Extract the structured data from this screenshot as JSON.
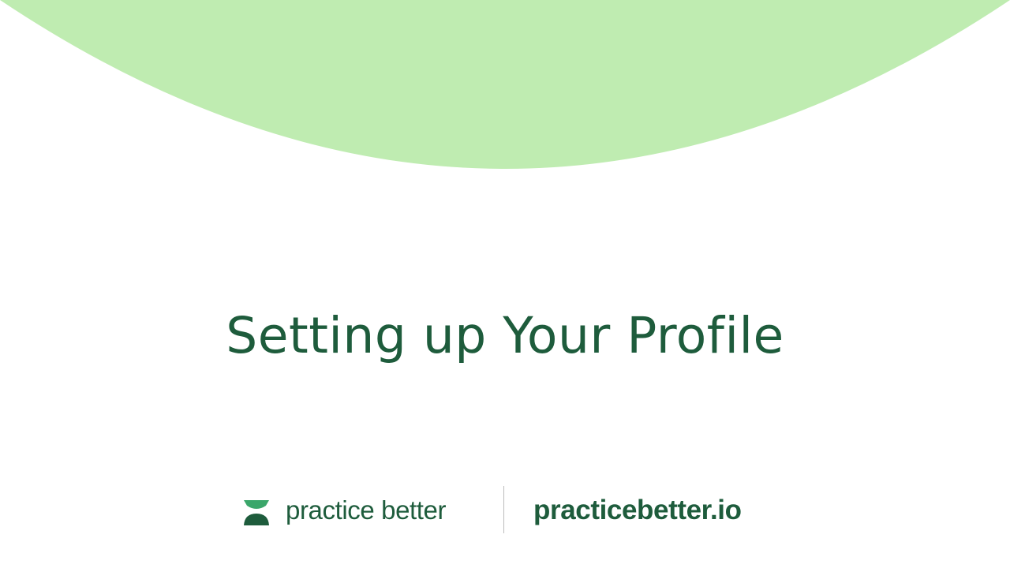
{
  "slide": {
    "title": "Setting up Your Profile"
  },
  "footer": {
    "brand_name": "practice better",
    "website": "practicebetter.io"
  },
  "colors": {
    "arc": "#bfecb1",
    "title_text": "#1e5c3c",
    "logo_top": "#3aa66a",
    "logo_bottom": "#1e5c3c",
    "divider": "#bcbcbc",
    "background": "#ffffff"
  },
  "icons": {
    "logo": "practice-better-logo-icon"
  }
}
